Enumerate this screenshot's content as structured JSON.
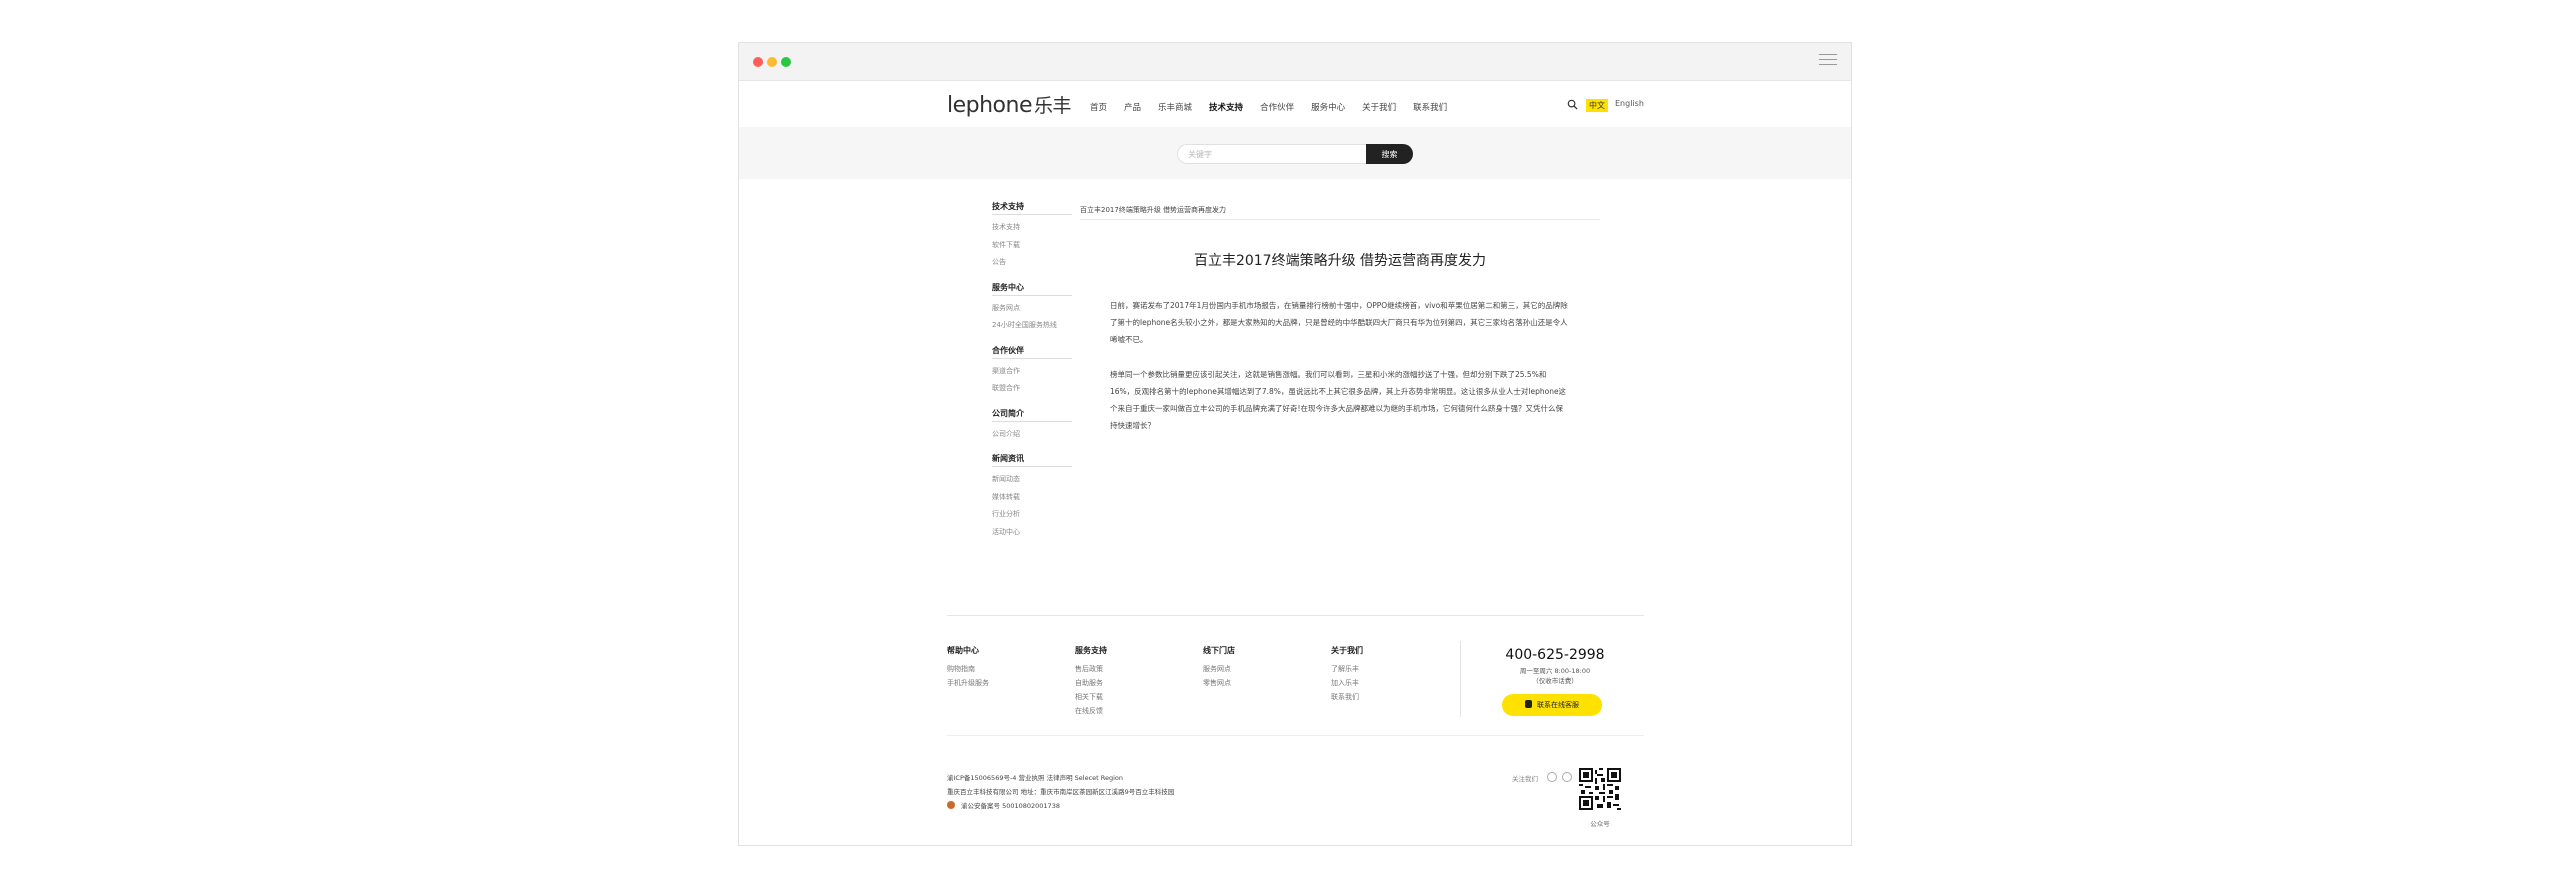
{
  "header": {
    "logo_text": "lephone",
    "logo_cn": "乐丰",
    "nav": [
      "首页",
      "产品",
      "乐丰商城",
      "技术支持",
      "合作伙伴",
      "服务中心",
      "关于我们",
      "联系我们"
    ],
    "active_nav": "技术支持",
    "lang_cn": "中文",
    "lang_en": "English"
  },
  "search": {
    "placeholder": "关键字",
    "button": "搜索"
  },
  "sidebar": [
    {
      "title": "技术支持",
      "items": [
        "技术支持",
        "软件下载",
        "公告"
      ]
    },
    {
      "title": "服务中心",
      "items": [
        "服务网点",
        "24小时全国服务热线"
      ]
    },
    {
      "title": "合作伙伴",
      "items": [
        "渠道合作",
        "联盟合作"
      ]
    },
    {
      "title": "公司简介",
      "items": [
        "公司介绍"
      ]
    },
    {
      "title": "新闻资讯",
      "items": [
        "新闻动态",
        "媒体转载",
        "行业分析",
        "活动中心"
      ]
    }
  ],
  "article": {
    "breadcrumb": "百立丰2017终端策略升级 借势运营商再度发力",
    "title": "百立丰2017终端策略升级 借势运营商再度发力",
    "paragraph1": "日前，赛诺发布了2017年1月份国内手机市场报告，在销量排行榜前十强中，OPPO继续榜首，vivo和苹果位居第二和第三，其它的品牌除了第十的lephone名头较小之外，都是大家熟知的大品牌，只是曾经的中华酷联四大厂商只有华为位列第四，其它三家均名落孙山还是令人唏嘘不已。",
    "paragraph2": "榜单同一个参数比销量更应该引起关注，这就是销售涨幅。我们可以看到，三星和小米的涨幅抄送了十强，但却分别下跌了25.5%和16%，反观排名第十的lephone其增幅达到了7.8%，虽说远比不上其它很多品牌，其上升态势非常明显。这让很多从业人士对lephone这个来自于重庆一家叫做百立丰公司的手机品牌充满了好奇!在现今许多大品牌都难以为继的手机市场，它何德何什么跻身十强？又凭什么保持快速增长？"
  },
  "footer": {
    "columns": [
      {
        "title": "帮助中心",
        "items": [
          "购物指南",
          "手机升级服务"
        ]
      },
      {
        "title": "服务支持",
        "items": [
          "售后政策",
          "自助服务",
          "相关下载",
          "在线反馈"
        ]
      },
      {
        "title": "线下门店",
        "items": [
          "服务网点",
          "零售网点"
        ]
      },
      {
        "title": "关于我们",
        "items": [
          "了解乐丰",
          "加入乐丰",
          "联系我们"
        ]
      }
    ],
    "phone": "400-625-2998",
    "hours_line1": "周一至周六 8:00-18:00",
    "hours_line2": "（仅收市话费）",
    "service_button": "联系在线客服",
    "icp_line1": "渝ICP备15006569号-4 营业执照 法律声明 Selecet Region",
    "icp_line2": "重庆百立丰科技有限公司 地址：重庆市南岸区茶园新区江溪路9号百立丰科技园",
    "icp_line3": "渝公安备案号 50010802001738",
    "follow_label": "关注我们",
    "qr_label": "公众号"
  }
}
